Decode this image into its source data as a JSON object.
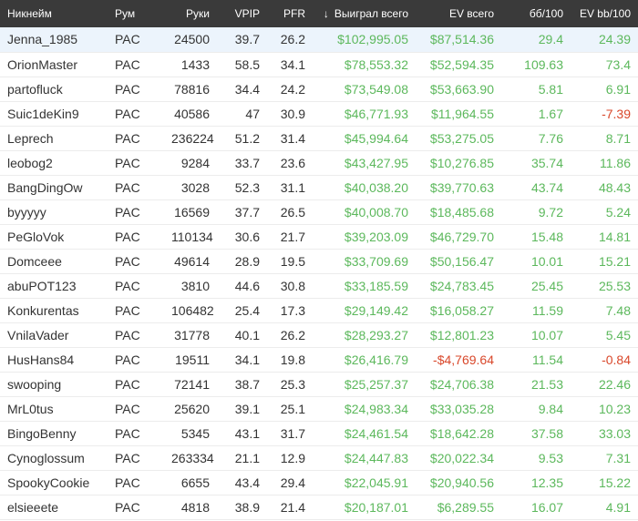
{
  "colors": {
    "header_bg": "#3a3a3a",
    "positive": "#5cb85c",
    "negative": "#d9482b",
    "highlight_row": "#ecf4fc"
  },
  "sort": {
    "column": "winnings",
    "icon": "arrow-down-icon",
    "direction": "desc"
  },
  "columns": {
    "nickname": "Никнейм",
    "room": "Рум",
    "hands": "Руки",
    "vpip": "VPIP",
    "pfr": "PFR",
    "winnings": "Выиграл всего",
    "ev_total": "EV всего",
    "bb100": "бб/100",
    "ev_bb100": "EV bb/100"
  },
  "rows": [
    {
      "nickname": "Jenna_1985",
      "room": "PAC",
      "hands": "24500",
      "vpip": "39.7",
      "pfr": "26.2",
      "winnings": "$102,995.05",
      "ev_total": "$87,514.36",
      "bb100": "29.4",
      "ev_bb100": "24.39"
    },
    {
      "nickname": "OrionMaster",
      "room": "PAC",
      "hands": "1433",
      "vpip": "58.5",
      "pfr": "34.1",
      "winnings": "$78,553.32",
      "ev_total": "$52,594.35",
      "bb100": "109.63",
      "ev_bb100": "73.4"
    },
    {
      "nickname": "partofluck",
      "room": "PAC",
      "hands": "78816",
      "vpip": "34.4",
      "pfr": "24.2",
      "winnings": "$73,549.08",
      "ev_total": "$53,663.90",
      "bb100": "5.81",
      "ev_bb100": "6.91"
    },
    {
      "nickname": "Suic1deKin9",
      "room": "PAC",
      "hands": "40586",
      "vpip": "47",
      "pfr": "30.9",
      "winnings": "$46,771.93",
      "ev_total": "$11,964.55",
      "bb100": "1.67",
      "ev_bb100": "-7.39"
    },
    {
      "nickname": "Leprech",
      "room": "PAC",
      "hands": "236224",
      "vpip": "51.2",
      "pfr": "31.4",
      "winnings": "$45,994.64",
      "ev_total": "$53,275.05",
      "bb100": "7.76",
      "ev_bb100": "8.71"
    },
    {
      "nickname": "leobog2",
      "room": "PAC",
      "hands": "9284",
      "vpip": "33.7",
      "pfr": "23.6",
      "winnings": "$43,427.95",
      "ev_total": "$10,276.85",
      "bb100": "35.74",
      "ev_bb100": "11.86"
    },
    {
      "nickname": "BangDingOw",
      "room": "PAC",
      "hands": "3028",
      "vpip": "52.3",
      "pfr": "31.1",
      "winnings": "$40,038.20",
      "ev_total": "$39,770.63",
      "bb100": "43.74",
      "ev_bb100": "48.43"
    },
    {
      "nickname": "byyyyy",
      "room": "PAC",
      "hands": "16569",
      "vpip": "37.7",
      "pfr": "26.5",
      "winnings": "$40,008.70",
      "ev_total": "$18,485.68",
      "bb100": "9.72",
      "ev_bb100": "5.24"
    },
    {
      "nickname": "PeGloVok",
      "room": "PAC",
      "hands": "110134",
      "vpip": "30.6",
      "pfr": "21.7",
      "winnings": "$39,203.09",
      "ev_total": "$46,729.70",
      "bb100": "15.48",
      "ev_bb100": "14.81"
    },
    {
      "nickname": "Domceee",
      "room": "PAC",
      "hands": "49614",
      "vpip": "28.9",
      "pfr": "19.5",
      "winnings": "$33,709.69",
      "ev_total": "$50,156.47",
      "bb100": "10.01",
      "ev_bb100": "15.21"
    },
    {
      "nickname": "abuPOT123",
      "room": "PAC",
      "hands": "3810",
      "vpip": "44.6",
      "pfr": "30.8",
      "winnings": "$33,185.59",
      "ev_total": "$24,783.45",
      "bb100": "25.45",
      "ev_bb100": "25.53"
    },
    {
      "nickname": "Konkurentas",
      "room": "PAC",
      "hands": "106482",
      "vpip": "25.4",
      "pfr": "17.3",
      "winnings": "$29,149.42",
      "ev_total": "$16,058.27",
      "bb100": "11.59",
      "ev_bb100": "7.48"
    },
    {
      "nickname": "VnilaVader",
      "room": "PAC",
      "hands": "31778",
      "vpip": "40.1",
      "pfr": "26.2",
      "winnings": "$28,293.27",
      "ev_total": "$12,801.23",
      "bb100": "10.07",
      "ev_bb100": "5.45"
    },
    {
      "nickname": "HusHans84",
      "room": "PAC",
      "hands": "19511",
      "vpip": "34.1",
      "pfr": "19.8",
      "winnings": "$26,416.79",
      "ev_total": "-$4,769.64",
      "bb100": "11.54",
      "ev_bb100": "-0.84"
    },
    {
      "nickname": "swooping",
      "room": "PAC",
      "hands": "72141",
      "vpip": "38.7",
      "pfr": "25.3",
      "winnings": "$25,257.37",
      "ev_total": "$24,706.38",
      "bb100": "21.53",
      "ev_bb100": "22.46"
    },
    {
      "nickname": "MrL0tus",
      "room": "PAC",
      "hands": "25620",
      "vpip": "39.1",
      "pfr": "25.1",
      "winnings": "$24,983.34",
      "ev_total": "$33,035.28",
      "bb100": "9.84",
      "ev_bb100": "10.23"
    },
    {
      "nickname": "BingoBenny",
      "room": "PAC",
      "hands": "5345",
      "vpip": "43.1",
      "pfr": "31.7",
      "winnings": "$24,461.54",
      "ev_total": "$18,642.28",
      "bb100": "37.58",
      "ev_bb100": "33.03"
    },
    {
      "nickname": "Cynoglossum",
      "room": "PAC",
      "hands": "263334",
      "vpip": "21.1",
      "pfr": "12.9",
      "winnings": "$24,447.83",
      "ev_total": "$20,022.34",
      "bb100": "9.53",
      "ev_bb100": "7.31"
    },
    {
      "nickname": "SpookyCookie",
      "room": "PAC",
      "hands": "6655",
      "vpip": "43.4",
      "pfr": "29.4",
      "winnings": "$22,045.91",
      "ev_total": "$20,940.56",
      "bb100": "12.35",
      "ev_bb100": "15.22"
    },
    {
      "nickname": "elsieeete",
      "room": "PAC",
      "hands": "4818",
      "vpip": "38.9",
      "pfr": "21.4",
      "winnings": "$20,187.01",
      "ev_total": "$6,289.55",
      "bb100": "16.07",
      "ev_bb100": "4.91"
    }
  ]
}
